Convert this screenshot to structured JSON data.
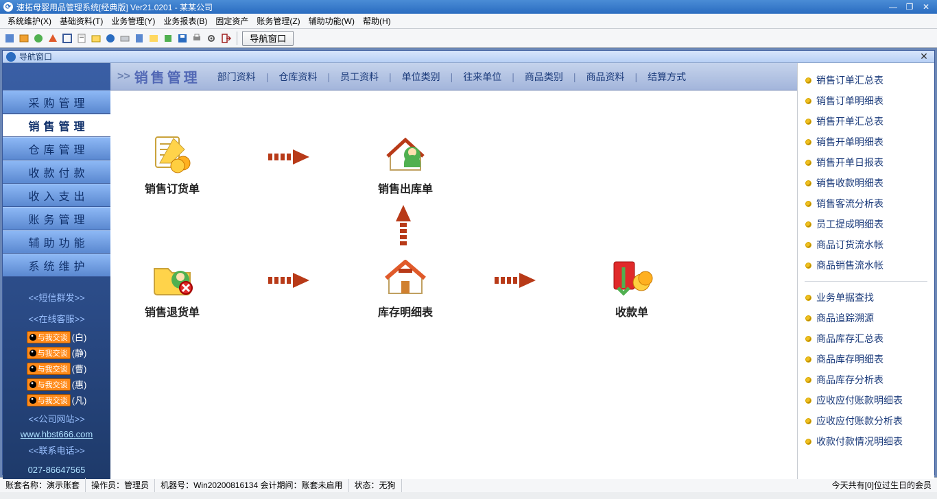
{
  "title": "速拓母婴用品管理系统[经典版] Ver21.0201  -  某某公司",
  "menus": [
    "系统维护(X)",
    "基础资料(T)",
    "业务管理(Y)",
    "业务报表(B)",
    "固定资产",
    "账务管理(Z)",
    "辅助功能(W)",
    "帮助(H)"
  ],
  "nav_button": "导航窗口",
  "inner_title": "导航窗口",
  "left_nav": {
    "items": [
      "采购管理",
      "销售管理",
      "仓库管理",
      "收款付款",
      "收入支出",
      "账务管理",
      "辅助功能",
      "系统维护"
    ],
    "selected_index": 1,
    "sms": "<<短信群发>>",
    "online": "<<在线客服>>",
    "qq_label": "与我交谈",
    "qq": [
      "(白)",
      "(静)",
      "(曹)",
      "(惠)",
      "(凡)"
    ],
    "site_label": "<<公司网站>>",
    "site_url": "www.hbst666.com",
    "phone_label": "<<联系电话>>",
    "phone": "027-86647565"
  },
  "bread": {
    "section": "销售管理",
    "links": [
      "部门资料",
      "仓库资料",
      "员工资料",
      "单位类别",
      "往来单位",
      "商品类别",
      "商品资料",
      "结算方式"
    ]
  },
  "flow": {
    "order": "销售订货单",
    "out": "销售出库单",
    "ret": "销售退货单",
    "stock": "库存明细表",
    "recv": "收款单"
  },
  "right": {
    "group1": [
      "销售订单汇总表",
      "销售订单明细表",
      "销售开单汇总表",
      "销售开单明细表",
      "销售开单日报表",
      "销售收款明细表",
      "销售客流分析表",
      "员工提成明细表",
      "商品订货流水帐",
      "商品销售流水帐"
    ],
    "group2": [
      "业务单据查找",
      "商品追踪溯源",
      "商品库存汇总表",
      "商品库存明细表",
      "商品库存分析表",
      "应收应付账款明细表",
      "应收应付账款分析表",
      "收款付款情况明细表"
    ]
  },
  "status": {
    "acct_l": "账套名称：",
    "acct_v": "演示账套",
    "op_l": "操作员：",
    "op_v": "管理员",
    "host_l": "机器号：",
    "host_v": "Win20200816134 会计期间：账套未启用",
    "state_l": "状态：",
    "state_v": "无狗",
    "birthday": "今天共有[0]位过生日的会员"
  }
}
